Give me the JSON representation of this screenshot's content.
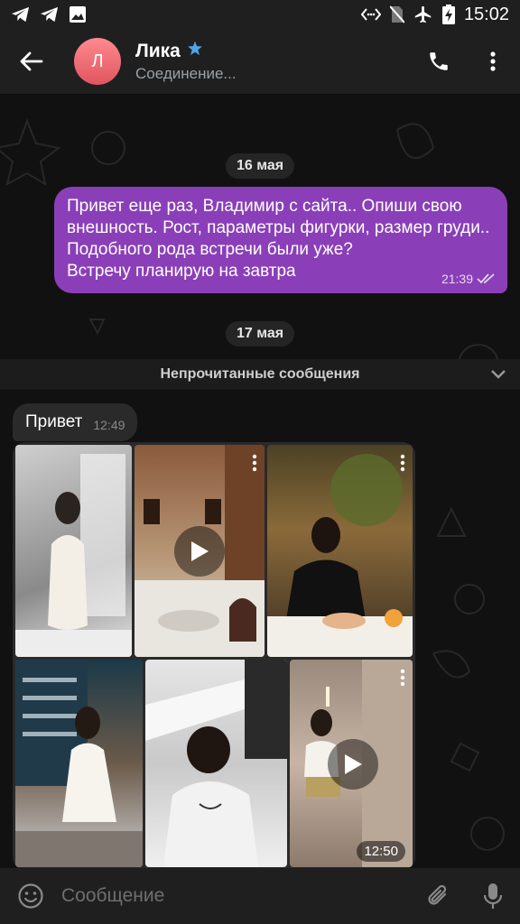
{
  "status_bar": {
    "time": "15:02",
    "left_icons": [
      "telegram-icon",
      "telegram-icon",
      "image-icon"
    ],
    "right_icons": [
      "nfc-icon",
      "no-sim-icon",
      "airplane-icon",
      "battery-charging-icon"
    ]
  },
  "header": {
    "avatar_letter": "Л",
    "name": "Лика",
    "subtitle": "Соединение...",
    "verified_icon": "star-badge-icon",
    "colors": {
      "avatar": "#e0555f",
      "badge": "#4fa3e8"
    }
  },
  "chat": {
    "date_1": "16 мая",
    "outgoing_message": {
      "text": "Привет еще раз, Владимир с сайта.. Опиши свою внешность. Рост, параметры фигурки, размер груди..\nПодобного рода встречи были уже?\nВстречу планирую на завтра",
      "time": "21:39",
      "status_icon": "double-check-icon",
      "color": "#8a3fb8"
    },
    "date_2": "17 мая",
    "unread_label": "Непрочитанные сообщения",
    "incoming_message": {
      "text": "Привет",
      "time": "12:49"
    },
    "album": {
      "time": "12:50",
      "items": [
        {
          "kind": "photo"
        },
        {
          "kind": "video"
        },
        {
          "kind": "photo"
        },
        {
          "kind": "photo"
        },
        {
          "kind": "photo"
        },
        {
          "kind": "video"
        }
      ]
    }
  },
  "composer": {
    "placeholder": "Сообщение",
    "value": "",
    "icons": [
      "emoji-icon",
      "paperclip-icon",
      "microphone-icon"
    ]
  }
}
